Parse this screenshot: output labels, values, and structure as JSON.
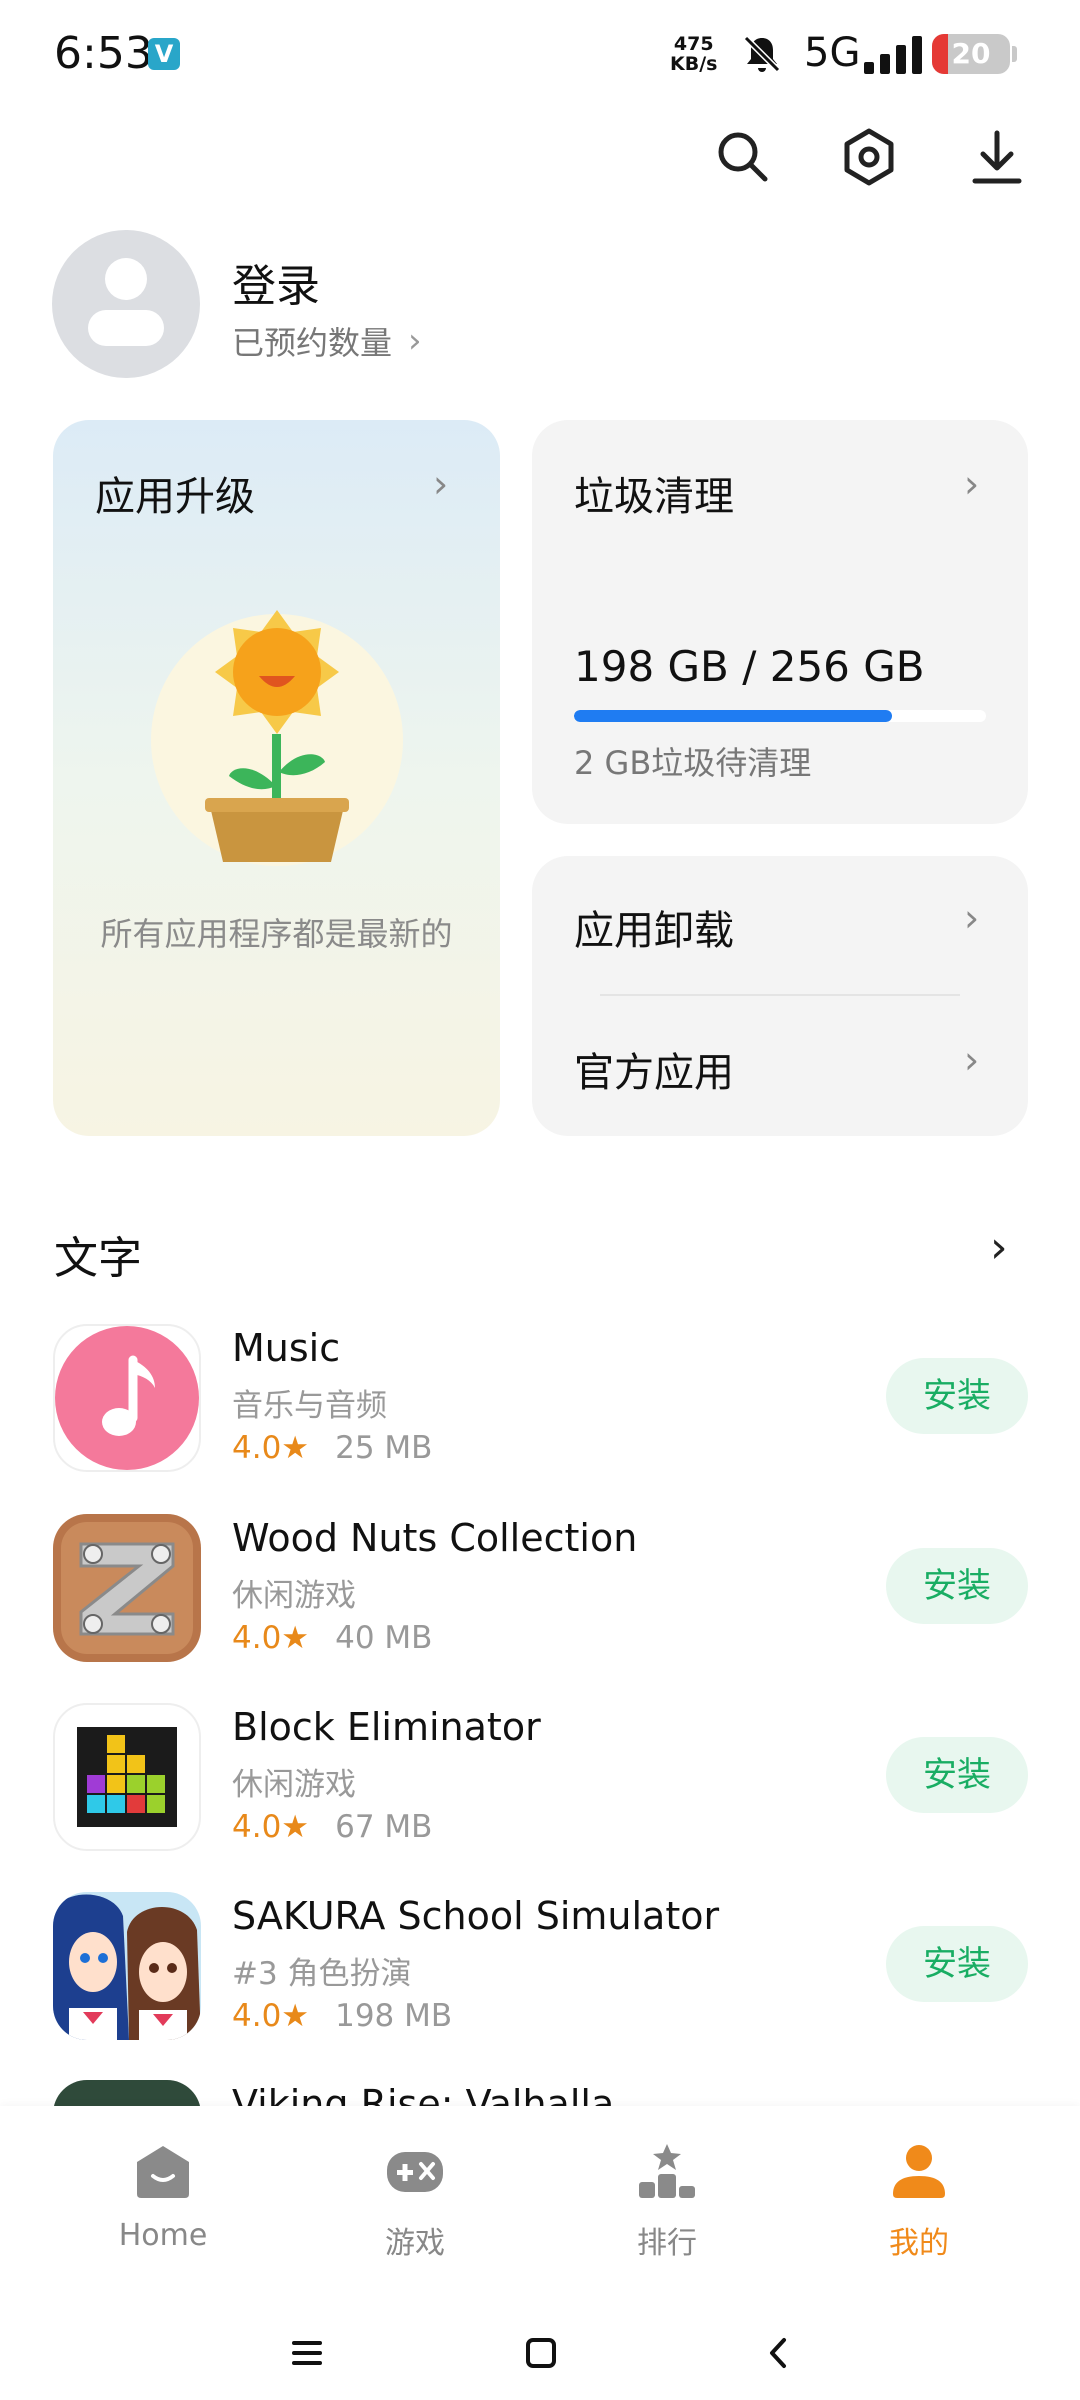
{
  "status_bar": {
    "time": "6:53",
    "badge": "V",
    "net_speed_value": "475",
    "net_speed_unit": "KB/s",
    "network": "5G",
    "battery": "20",
    "battery_level": 0.2
  },
  "profile": {
    "login_label": "登录",
    "reserve_label": "已预约数量"
  },
  "cards": {
    "upgrade": {
      "title": "应用升级",
      "message": "所有应用程序都是最新的"
    },
    "clean": {
      "title": "垃圾清理",
      "storage_text": "198 GB / 256 GB",
      "storage_used_fraction": 0.773,
      "junk_text": "2 GB垃圾待清理"
    },
    "uninstall": {
      "title": "应用卸载"
    },
    "official": {
      "title": "官方应用"
    }
  },
  "section": {
    "title": "文字"
  },
  "apps": [
    {
      "name": "Music",
      "category": "音乐与音频",
      "rating": "4.0★",
      "size": "25 MB",
      "action": "安装",
      "icon": "music-note-icon"
    },
    {
      "name": "Wood Nuts Collection",
      "category": "休闲游戏",
      "rating": "4.0★",
      "size": "40 MB",
      "action": "安装",
      "icon": "wood-nuts-icon"
    },
    {
      "name": "Block Eliminator",
      "category": "休闲游戏",
      "rating": "4.0★",
      "size": "67 MB",
      "action": "安装",
      "icon": "block-eliminator-icon"
    },
    {
      "name": "SAKURA School Simulator",
      "category": "#3 角色扮演",
      "rating": "4.0★",
      "size": "198 MB",
      "action": "安装",
      "icon": "sakura-icon"
    },
    {
      "name": "Viking Rise: Valhalla",
      "category": "",
      "rating": "",
      "size": "",
      "action": "",
      "icon": "viking-rise-icon"
    }
  ],
  "bottom_nav": {
    "items": [
      {
        "label": "Home",
        "icon": "home-icon"
      },
      {
        "label": "游戏",
        "icon": "gamepad-icon"
      },
      {
        "label": "排行",
        "icon": "ranking-icon"
      },
      {
        "label": "我的",
        "icon": "profile-icon"
      }
    ],
    "active_index": 3
  },
  "colors": {
    "accent_orange": "#f08a1a",
    "install_green": "#19ad63",
    "progress_blue": "#1f7cf2",
    "rating_orange": "#e8891a"
  }
}
